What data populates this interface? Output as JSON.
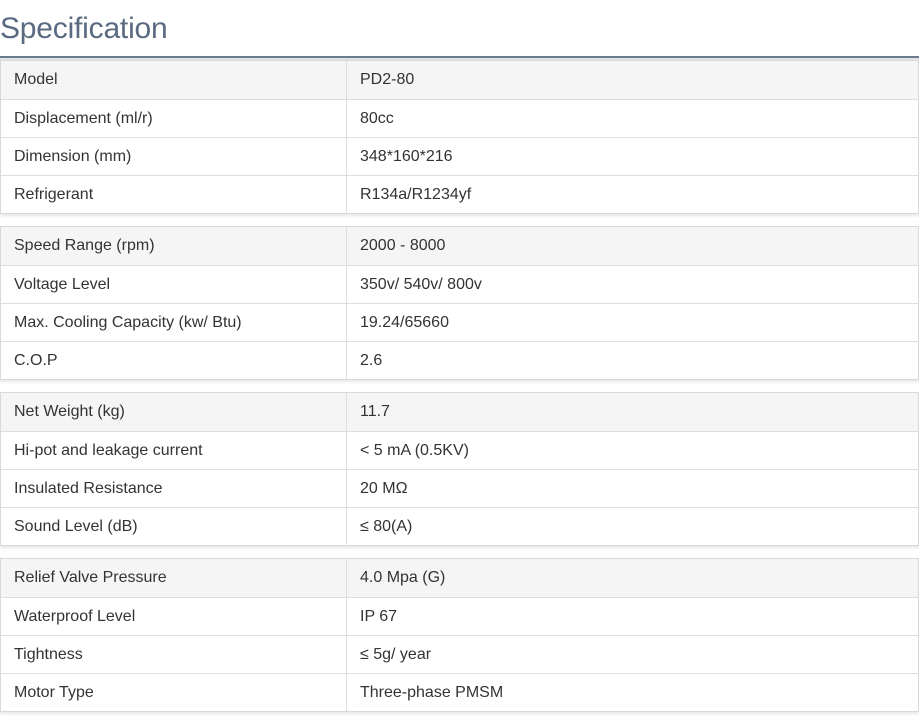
{
  "page": {
    "title": "Specification"
  },
  "groups": [
    {
      "rows": [
        {
          "label": "Model",
          "value": "PD2-80"
        },
        {
          "label": "Displacement (ml/r)",
          "value": "80cc"
        },
        {
          "label": "Dimension (mm)",
          "value": "348*160*216"
        },
        {
          "label": "Refrigerant",
          "value": "R134a/R1234yf"
        }
      ]
    },
    {
      "rows": [
        {
          "label": "Speed Range (rpm)",
          "value": "2000 - 8000"
        },
        {
          "label": "Voltage Level",
          "value": "350v/ 540v/ 800v"
        },
        {
          "label": "Max. Cooling Capacity (kw/ Btu)",
          "value": "19.24/65660"
        },
        {
          "label": "C.O.P",
          "value": "2.6"
        }
      ]
    },
    {
      "rows": [
        {
          "label": "Net Weight (kg)",
          "value": "11.7"
        },
        {
          "label": "Hi-pot and leakage current",
          "value": "< 5 mA (0.5KV)"
        },
        {
          "label": "Insulated Resistance",
          "value": "20 MΩ"
        },
        {
          "label": "Sound Level (dB)",
          "value": "≤ 80(A)"
        }
      ]
    },
    {
      "rows": [
        {
          "label": "Relief Valve Pressure",
          "value": "4.0 Mpa (G)"
        },
        {
          "label": "Waterproof Level",
          "value": "IP 67"
        },
        {
          "label": "Tightness",
          "value": "≤ 5g/ year"
        },
        {
          "label": "Motor Type",
          "value": "Three-phase PMSM"
        }
      ]
    }
  ]
}
